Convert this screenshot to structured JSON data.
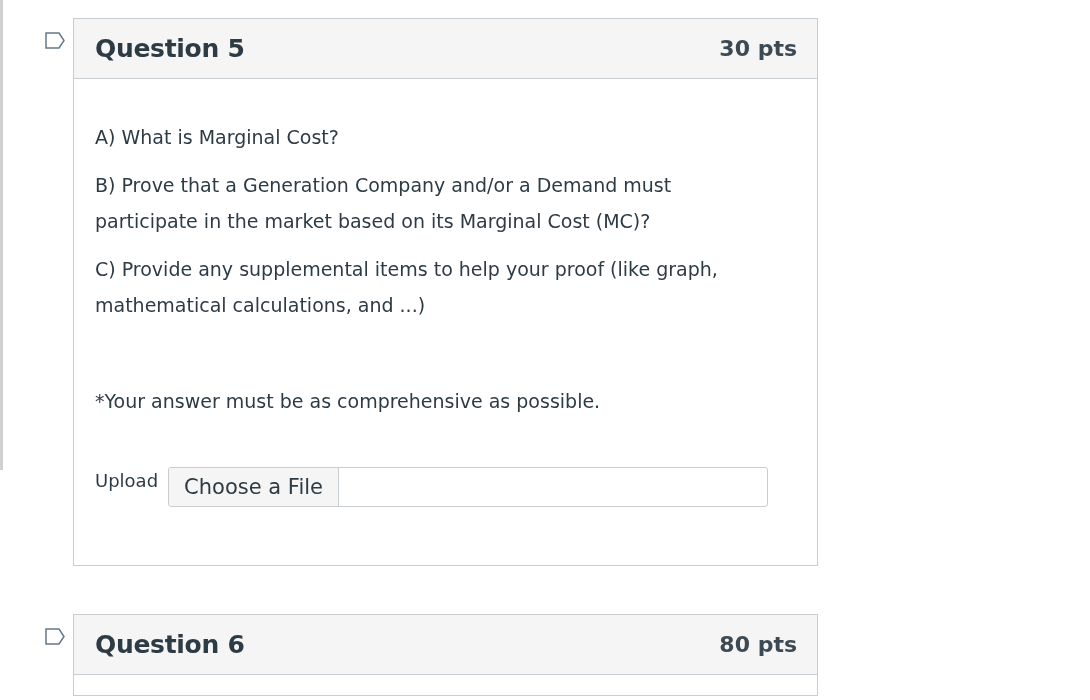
{
  "questions": [
    {
      "title": "Question 5",
      "points": "30 pts",
      "flagged": false,
      "paragraphs": [
        "A) What is Marginal Cost?",
        "B) Prove that a Generation Company and/or a Demand must participate in the market based on its Marginal Cost (MC)?",
        "C) Provide any supplemental items to help your proof (like graph, mathematical calculations, and ...)"
      ],
      "note": "*Your answer must be as comprehensive as possible.",
      "upload": {
        "label": "Upload",
        "button": "Choose a File"
      }
    },
    {
      "title": "Question 6",
      "points": "80 pts",
      "flagged": false
    }
  ]
}
